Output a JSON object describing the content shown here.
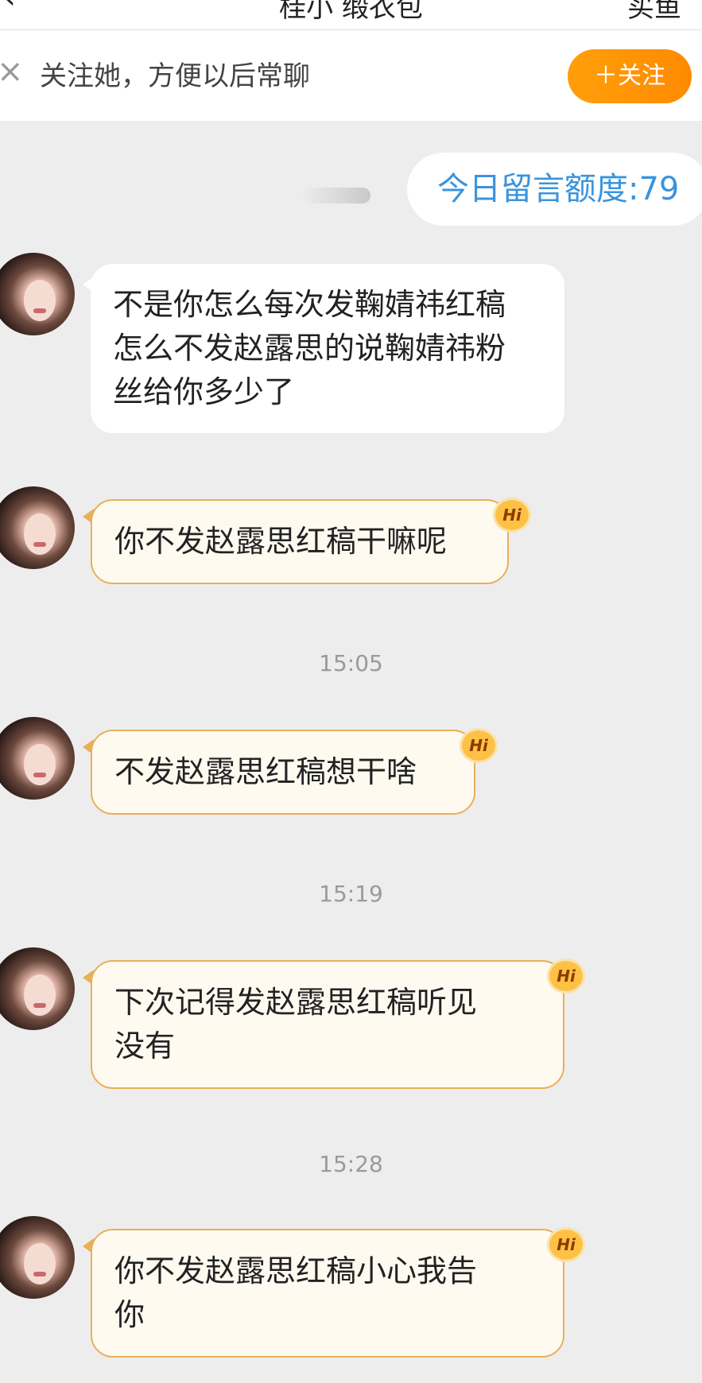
{
  "header": {
    "back_icon": "chevron-left-icon",
    "title": "桂小 缎衣包",
    "right_label": "买鱼"
  },
  "follow_banner": {
    "text": "关注她，方便以后常聊",
    "button": "＋关注"
  },
  "quota": "今日留言额度:79",
  "messages": [
    {
      "type": "text",
      "text": "不是你怎么每次发鞠婧祎红稿\n怎么不发赵露思的说鞠婧祎粉\n丝给你多少了",
      "hi": false
    },
    {
      "type": "text",
      "text": "你不发赵露思红稿干嘛呢",
      "hi": true
    },
    {
      "type": "time",
      "text": "15:05"
    },
    {
      "type": "text",
      "text": "不发赵露思红稿想干啥",
      "hi": true
    },
    {
      "type": "time",
      "text": "15:19"
    },
    {
      "type": "text",
      "text": "下次记得发赵露思红稿听见\n没有",
      "hi": true
    },
    {
      "type": "time",
      "text": "15:28"
    },
    {
      "type": "text",
      "text": "你不发赵露思红稿小心我告\n你",
      "hi": true
    }
  ],
  "hi_badge_label": "Hi",
  "colors": {
    "accent_orange": "#ff8a00",
    "quota_blue": "#3a94dc",
    "hi_border": "#e8b057",
    "background": "#ededed"
  }
}
